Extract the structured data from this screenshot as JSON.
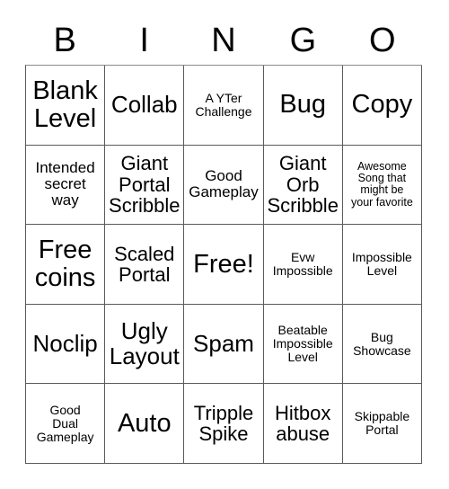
{
  "card": {
    "header_letters": [
      "B",
      "I",
      "N",
      "G",
      "O"
    ],
    "rows": [
      [
        {
          "text": "Blank\nLevel",
          "size": "fs-xl"
        },
        {
          "text": "Collab",
          "size": "fs-lg"
        },
        {
          "text": "A YTer\nChallenge",
          "size": "fs-xs"
        },
        {
          "text": "Bug",
          "size": "fs-xl"
        },
        {
          "text": "Copy",
          "size": "fs-xl"
        }
      ],
      [
        {
          "text": "Intended\nsecret\nway",
          "size": "fs-sm"
        },
        {
          "text": "Giant\nPortal\nScribble",
          "size": "fs-md"
        },
        {
          "text": "Good\nGameplay",
          "size": "fs-sm"
        },
        {
          "text": "Giant\nOrb\nScribble",
          "size": "fs-md"
        },
        {
          "text": "Awesome\nSong that\nmight be\nyour favorite",
          "size": "fs-xxs"
        }
      ],
      [
        {
          "text": "Free\ncoins",
          "size": "fs-xl"
        },
        {
          "text": "Scaled\nPortal",
          "size": "fs-md"
        },
        {
          "text": "Free!",
          "size": "fs-xl"
        },
        {
          "text": "Evw\nImpossible",
          "size": "fs-xs"
        },
        {
          "text": "Impossible\nLevel",
          "size": "fs-xs"
        }
      ],
      [
        {
          "text": "Noclip",
          "size": "fs-lg"
        },
        {
          "text": "Ugly\nLayout",
          "size": "fs-lg"
        },
        {
          "text": "Spam",
          "size": "fs-lg"
        },
        {
          "text": "Beatable\nImpossible\nLevel",
          "size": "fs-xs"
        },
        {
          "text": "Bug\nShowcase",
          "size": "fs-xs"
        }
      ],
      [
        {
          "text": "Good\nDual\nGameplay",
          "size": "fs-xs"
        },
        {
          "text": "Auto",
          "size": "fs-xl"
        },
        {
          "text": "Tripple\nSpike",
          "size": "fs-md"
        },
        {
          "text": "Hitbox\nabuse",
          "size": "fs-md"
        },
        {
          "text": "Skippable\nPortal",
          "size": "fs-xs"
        }
      ]
    ]
  }
}
